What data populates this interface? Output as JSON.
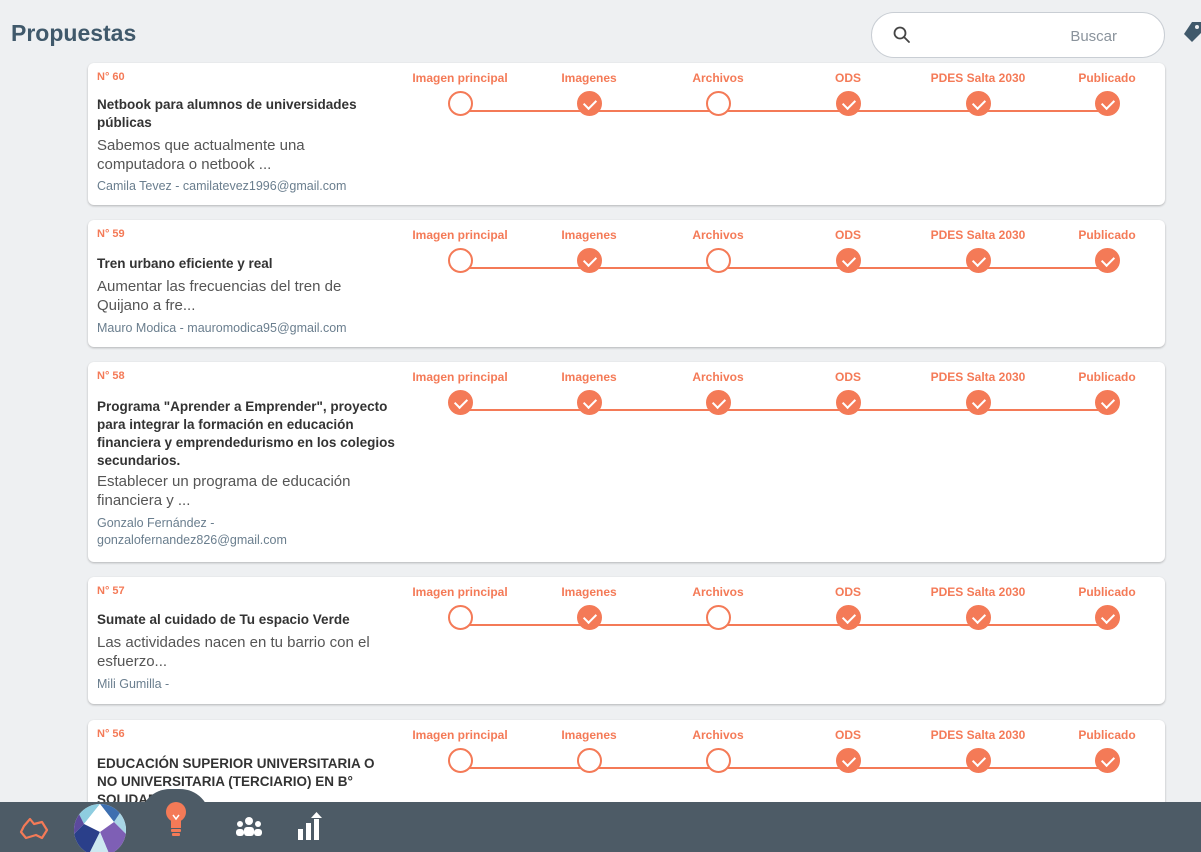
{
  "header": {
    "title": "Propuestas",
    "search_placeholder": "Buscar"
  },
  "step_labels": [
    "Imagen principal",
    "Imagenes",
    "Archivos",
    "ODS",
    "PDES Salta 2030",
    "Publicado"
  ],
  "proposals": [
    {
      "number": "N° 60",
      "title": "Netbook para alumnos de universidades públicas",
      "description": "Sabemos que actualmente una computadora o netbook ...",
      "author": "Camila Tevez - camilatevez1996@gmail.com",
      "steps": [
        false,
        true,
        false,
        true,
        true,
        true
      ]
    },
    {
      "number": "N° 59",
      "title": "Tren urbano eficiente y real",
      "description": "Aumentar las frecuencias del tren de Quijano a fre...",
      "author": "Mauro Modica - mauromodica95@gmail.com",
      "steps": [
        false,
        true,
        false,
        true,
        true,
        true
      ]
    },
    {
      "number": "N° 58",
      "title": "Programa \"Aprender a Emprender\", proyecto para integrar la formación en educación financiera y emprendedurismo en los colegios secundarios.",
      "description": "Establecer un programa de educación financiera y ...",
      "author": "Gonzalo Fernández - gonzalofernandez826@gmail.com",
      "steps": [
        true,
        true,
        true,
        true,
        true,
        true
      ]
    },
    {
      "number": "N° 57",
      "title": "Sumate al cuidado de Tu espacio Verde",
      "description": "Las actividades nacen en tu barrio con el esfuerzo...",
      "author": "Mili Gumilla -",
      "steps": [
        false,
        true,
        false,
        true,
        true,
        true
      ]
    },
    {
      "number": "N° 56",
      "title": "EDUCACIÓN SUPERIOR UNIVERSITARIA O NO UNIVERSITARIA (TERCIARIO) EN B° SOLIDARIDAD",
      "description": "",
      "author": "",
      "steps": [
        false,
        false,
        false,
        true,
        true,
        true
      ]
    }
  ],
  "bottom_nav": {
    "items": [
      "cloud-icon",
      "avatar",
      "lightbulb-icon",
      "people-icon",
      "stats-icon"
    ],
    "active_color": "#f47a57",
    "bar_color": "#4d5b66"
  },
  "colors": {
    "accent": "#f47a57",
    "title": "#40596b"
  }
}
